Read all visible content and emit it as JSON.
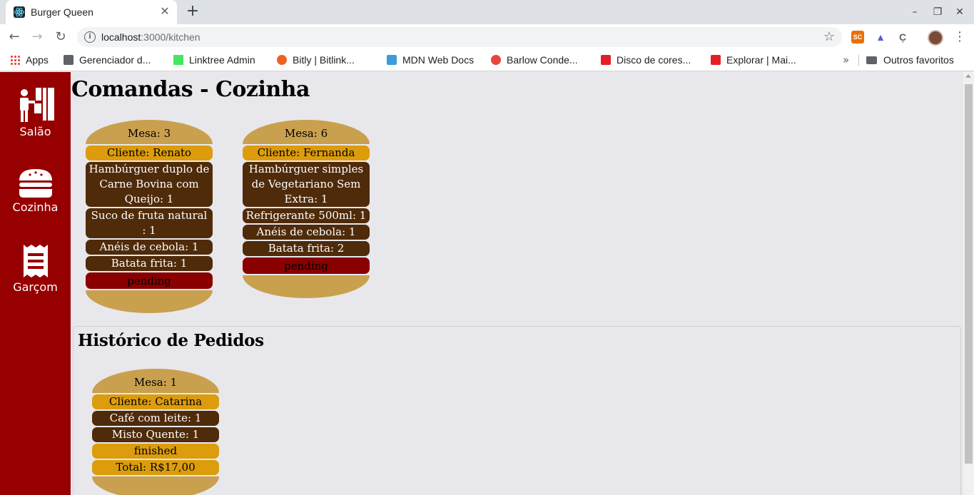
{
  "browser": {
    "tab_title": "Burger Queen",
    "tab_close": "✕",
    "new_tab": "+",
    "url_host": "localhost",
    "url_path": ":3000/kitchen",
    "bookmarks": [
      {
        "label": "Apps",
        "icon": "apps-grid-icon"
      },
      {
        "label": "Gerenciador d...",
        "icon": "manager-icon",
        "color": "#5f6368"
      },
      {
        "label": "Linktree Admin",
        "icon": "linktree-icon",
        "color": "#43e660"
      },
      {
        "label": "Bitly | Bitlink...",
        "icon": "bitly-icon",
        "color": "#ee6123"
      },
      {
        "label": "MDN Web Docs",
        "icon": "mdn-icon",
        "color": "#3a9dd8"
      },
      {
        "label": "Barlow Conde...",
        "icon": "fonts-icon",
        "color": "#e8453c"
      },
      {
        "label": "Disco de cores...",
        "icon": "adobe-icon",
        "color": "#e31e25"
      },
      {
        "label": "Explorar | Mai...",
        "icon": "adobe-icon",
        "color": "#e31e25"
      }
    ],
    "bookmarks_more": "»",
    "other_bookmarks": "Outros favoritos"
  },
  "sidebar": {
    "items": [
      {
        "label": "Salão",
        "icon": "waiter-icon"
      },
      {
        "label": "Cozinha",
        "icon": "burger-icon"
      },
      {
        "label": "Garçom",
        "icon": "receipt-icon"
      }
    ]
  },
  "main": {
    "title": "Comandas - Cozinha",
    "orders": [
      {
        "table": "Mesa: 3",
        "client": "Cliente: Renato",
        "items": [
          "Hambúrguer duplo de Carne Bovina com Queijo: 1",
          "Suco de fruta natural : 1",
          "Anéis de cebola: 1",
          "Batata frita: 1"
        ],
        "status": "pending"
      },
      {
        "table": "Mesa: 6",
        "client": "Cliente: Fernanda",
        "items": [
          "Hambúrguer simples de Vegetariano Sem Extra: 1",
          "Refrigerante 500ml: 1",
          "Anéis de cebola: 1",
          "Batata frita: 2"
        ],
        "status": "pending"
      }
    ]
  },
  "history": {
    "title": "Histórico de Pedidos",
    "orders": [
      {
        "table": "Mesa: 1",
        "client": "Cliente: Catarina",
        "items": [
          "Café com leite: 1",
          "Misto Quente: 1"
        ],
        "status": "finished",
        "total": "Total: R$17,00"
      }
    ]
  },
  "colors": {
    "sidebar": "#960000",
    "bun": "#c9a04e",
    "cheese": "#dc9c0c",
    "patty": "#4f2b0a",
    "pending": "#8a0000"
  }
}
